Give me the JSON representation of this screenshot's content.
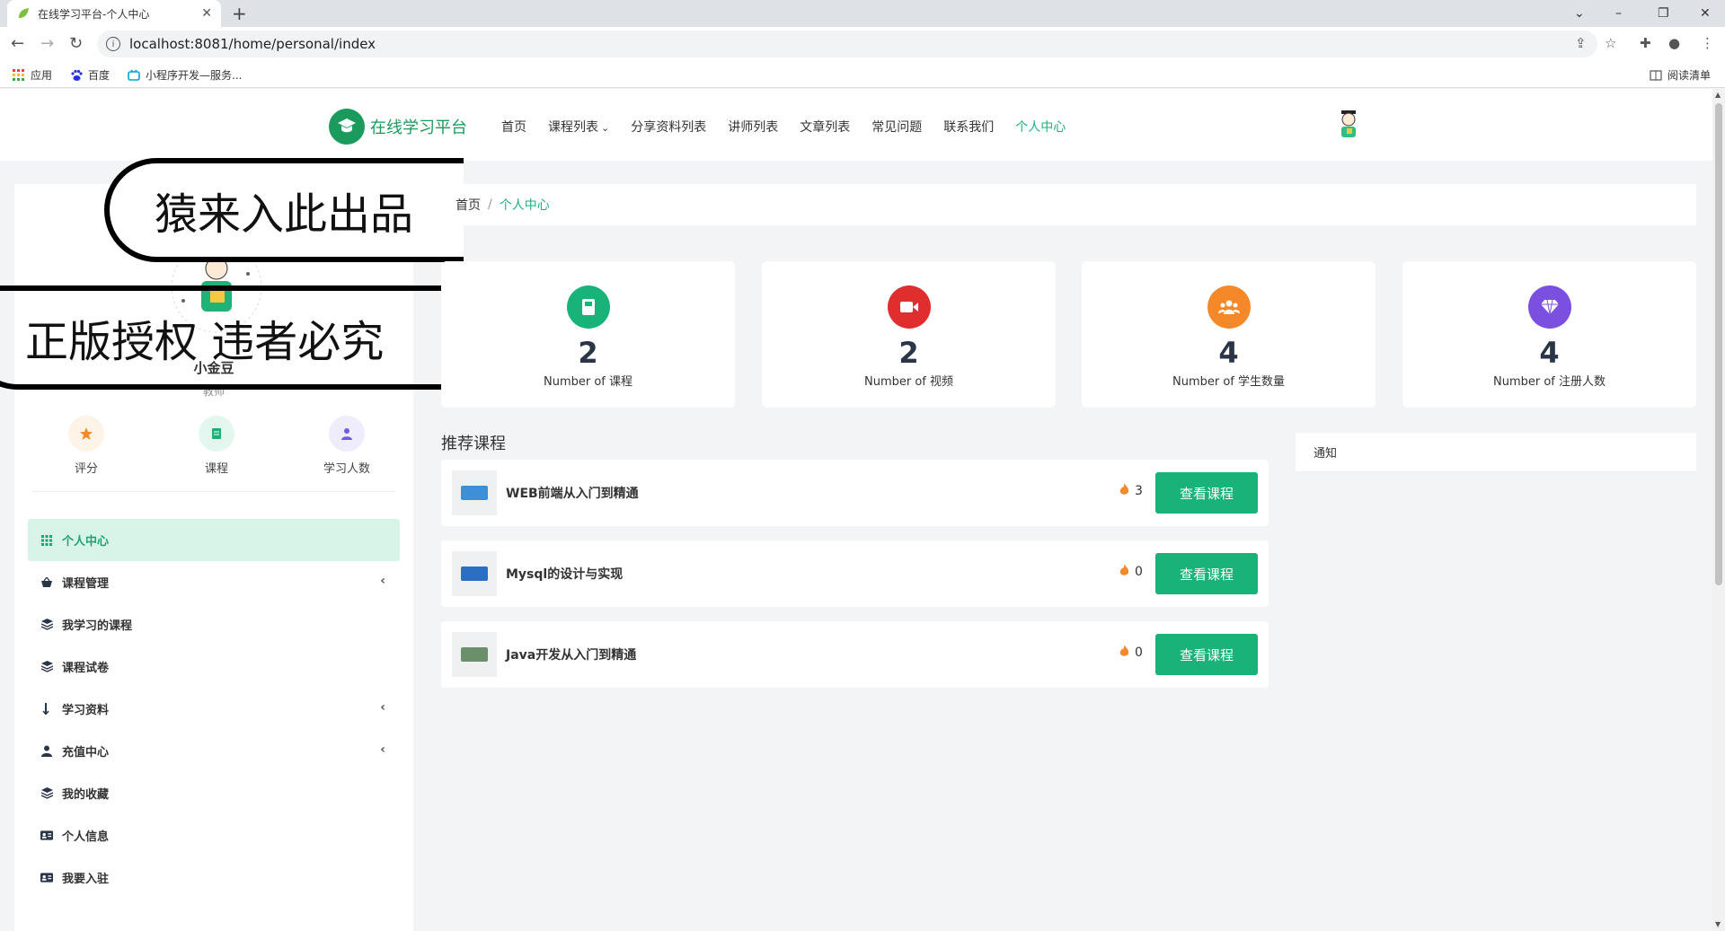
{
  "browser": {
    "tab_title": "在线学习平台-个人中心",
    "url": "localhost:8081/home/personal/index",
    "bookmarks": [
      "应用",
      "百度",
      "小程序开发—服务..."
    ],
    "reading_list": "阅读清单"
  },
  "header": {
    "logo_text": "在线学习平台",
    "menu": [
      "首页",
      "课程列表",
      "分享资料列表",
      "讲师列表",
      "文章列表",
      "常见问题",
      "联系我们",
      "个人中心"
    ],
    "menu_dropdown_marker": "⌄"
  },
  "watermark": {
    "line1": "猿来入此出品",
    "line2": "正版授权 违者必究"
  },
  "profile": {
    "name": "小金豆",
    "role": "教师",
    "stats": [
      {
        "label": "评分",
        "icon": "star-icon",
        "color": "#f5892a",
        "bg": "#fef3e7"
      },
      {
        "label": "课程",
        "icon": "document-icon",
        "color": "#19b37a",
        "bg": "#e4f7ee"
      },
      {
        "label": "学习人数",
        "icon": "user-icon",
        "color": "#6c5ce7",
        "bg": "#efecfc"
      }
    ]
  },
  "sidebar": {
    "items": [
      {
        "label": "个人中心",
        "icon": "grid-icon",
        "active": true,
        "chevron": false
      },
      {
        "label": "课程管理",
        "icon": "basket-icon",
        "active": false,
        "chevron": true
      },
      {
        "label": "我学习的课程",
        "icon": "layers-icon",
        "active": false,
        "chevron": false
      },
      {
        "label": "课程试卷",
        "icon": "layers-icon",
        "active": false,
        "chevron": false
      },
      {
        "label": "学习资料",
        "icon": "download-icon",
        "active": false,
        "chevron": true
      },
      {
        "label": "充值中心",
        "icon": "user-icon",
        "active": false,
        "chevron": true
      },
      {
        "label": "我的收藏",
        "icon": "layers-icon",
        "active": false,
        "chevron": false
      },
      {
        "label": "个人信息",
        "icon": "id-card-icon",
        "active": false,
        "chevron": false
      },
      {
        "label": "我要入驻",
        "icon": "id-card-icon",
        "active": false,
        "chevron": false
      }
    ]
  },
  "breadcrumb": {
    "home": "首页",
    "separator": "/",
    "current": "个人中心"
  },
  "cards": [
    {
      "value": "2",
      "caption": "Number of 课程",
      "icon": "book-icon",
      "color": "#19b37a"
    },
    {
      "value": "2",
      "caption": "Number of 视频",
      "icon": "video-icon",
      "color": "#e02d2d"
    },
    {
      "value": "4",
      "caption": "Number of 学生数量",
      "icon": "users-icon",
      "color": "#f5892a"
    },
    {
      "value": "4",
      "caption": "Number of 注册人数",
      "icon": "diamond-icon",
      "color": "#7b4fe0"
    }
  ],
  "recommend": {
    "title": "推荐课程",
    "button_label": "查看课程",
    "courses": [
      {
        "title": "WEB前端从入门到精通",
        "hot": "3",
        "thumb_color": "#3d8fd6"
      },
      {
        "title": "Mysql的设计与实现",
        "hot": "0",
        "thumb_color": "#2a6fc4"
      },
      {
        "title": "Java开发从入门到精通",
        "hot": "0",
        "thumb_color": "#6b8f6a"
      }
    ]
  },
  "notice": {
    "title": "通知"
  }
}
